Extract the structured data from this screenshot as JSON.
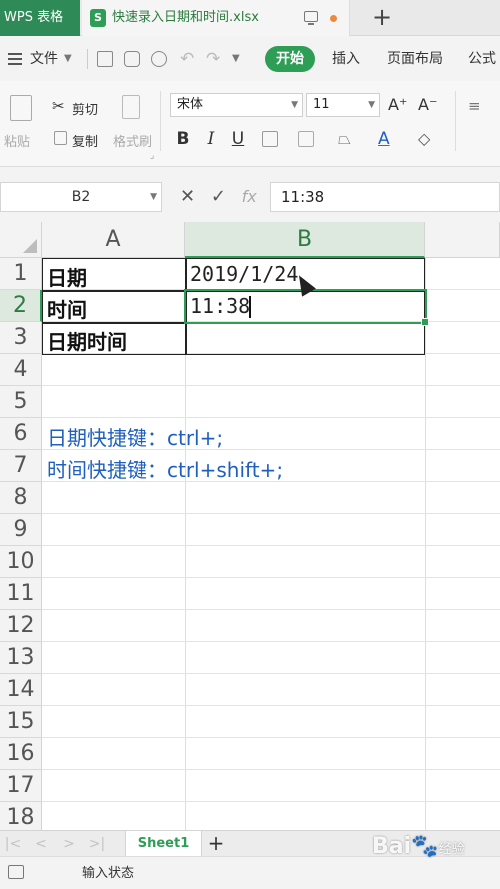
{
  "titlebar": {
    "app_tab": "WPS 表格",
    "file_tab": "快速录入日期和时间.xlsx",
    "file_icon_letter": "S",
    "new_tab": "+"
  },
  "menubar": {
    "file_menu": "文件",
    "tabs": [
      "开始",
      "插入",
      "页面布局",
      "公式"
    ]
  },
  "ribbon": {
    "paste": "粘贴",
    "cut": "剪切",
    "copy": "复制",
    "format_painter": "格式刷",
    "font_name": "宋体",
    "font_size": "11",
    "increase_font": "A⁺",
    "decrease_font": "A⁻",
    "bold": "B",
    "italic": "I",
    "underline": "U",
    "font_color_letter": "A"
  },
  "formula_bar": {
    "cell_ref": "B2",
    "cancel": "✕",
    "confirm": "✓",
    "fx": "fx",
    "value": "11:38"
  },
  "grid": {
    "columns": [
      "A",
      "B"
    ],
    "rows": [
      "1",
      "2",
      "3",
      "4",
      "5",
      "6",
      "7",
      "8",
      "9",
      "10",
      "11",
      "12",
      "13",
      "14",
      "15",
      "16",
      "17",
      "18"
    ],
    "cells": {
      "A1": "日期",
      "A2": "时间",
      "A3": "日期时间",
      "B1": "2019/1/24",
      "B2": "11:38",
      "A6": "日期快捷键：ctrl+;",
      "A7": "时间快捷键：ctrl+shift+;"
    },
    "selected_cell": "B2"
  },
  "sheets": {
    "tabs": [
      "Sheet1"
    ],
    "add": "+",
    "nav": [
      "|<",
      "<",
      ">",
      ">|"
    ]
  },
  "status": {
    "mode": "输入状态"
  },
  "watermark": {
    "text": "Bai",
    "paw": "🐾",
    "suffix": "经验"
  },
  "colors": {
    "accent": "#2e9d55",
    "blue_text": "#1f5fbf"
  }
}
